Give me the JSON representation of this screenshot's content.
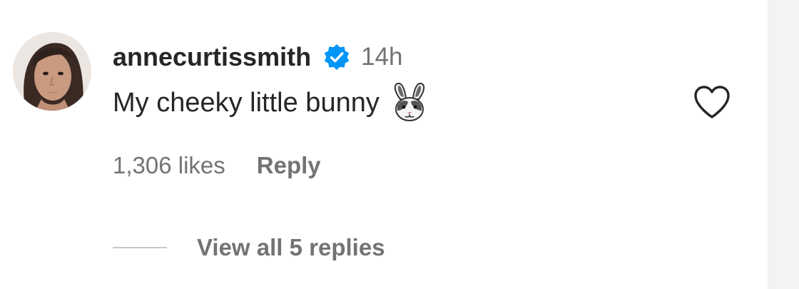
{
  "comment": {
    "username": "annecurtissmith",
    "verified_icon": "verified-badge-icon",
    "time": "14h",
    "text": "My cheeky little bunny",
    "emoji": "rabbit-face-emoji",
    "likes": "1,306 likes",
    "reply_label": "Reply",
    "view_replies_label": "View all 5 replies",
    "like_icon": "heart-icon"
  },
  "colors": {
    "text_primary": "#262626",
    "text_secondary": "#737373",
    "verified_blue": "#0095f6",
    "divider": "#c7c7c7"
  }
}
